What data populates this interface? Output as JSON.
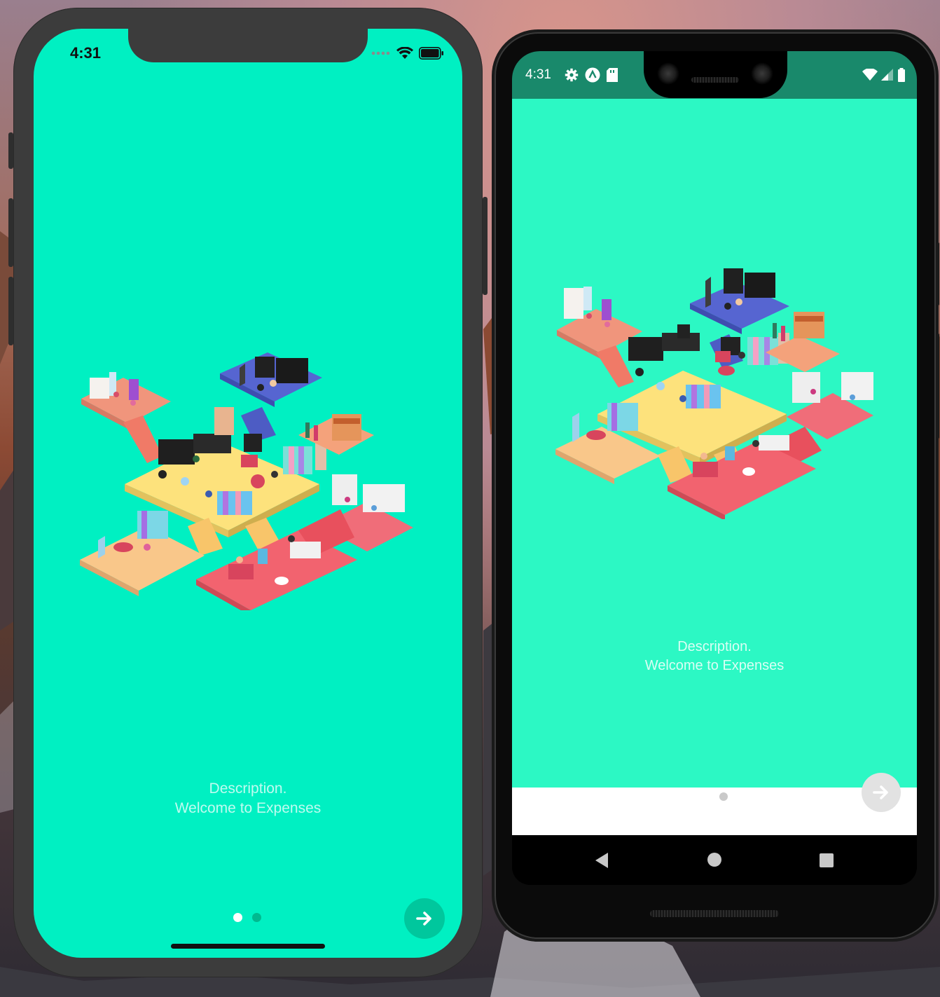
{
  "ios": {
    "status": {
      "time": "4:31"
    },
    "description_line1": "Description.",
    "description_line2": "Welcome to Expenses",
    "pagination": {
      "total": 2,
      "active": 0
    },
    "next_icon": "arrow-right-icon",
    "colors": {
      "background": "#00f0c2",
      "next_button": "#00c79d"
    }
  },
  "android": {
    "status": {
      "time": "4:31",
      "left_icons": [
        "settings-icon",
        "app-icon",
        "sd-card-icon"
      ],
      "right_icons": [
        "wifi-icon",
        "signal-icon",
        "battery-icon"
      ]
    },
    "description_line1": "Description.",
    "description_line2": "Welcome to Expenses",
    "pagination": {
      "total": 1,
      "active": 0
    },
    "next_icon": "arrow-right-icon",
    "nav": [
      "back-icon",
      "home-icon",
      "recents-icon"
    ],
    "colors": {
      "status_bar": "#19896b",
      "background": "#2cf8c4",
      "bottom_bar": "#ffffff",
      "next_button": "#e2e2e2"
    }
  }
}
